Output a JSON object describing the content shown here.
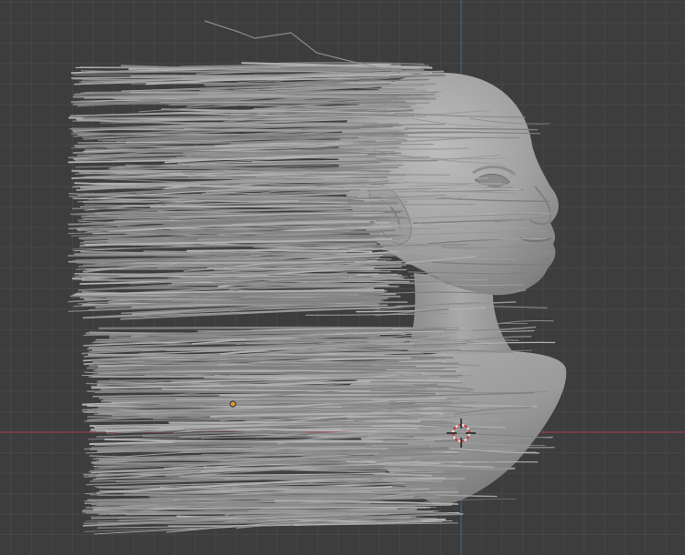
{
  "viewport": {
    "mode": "3d-viewport-orthographic-side",
    "background_color": "#3d3d3d",
    "grid_minor_color": "#464646",
    "grid_major_color": "#4f4f4f",
    "x_axis_color": "#a8404a",
    "z_axis_color": "#3b6fa8",
    "mesh_color": "#9a9a9a",
    "hair_color": "#8c8c8c",
    "origin_color": "#e39a2c"
  },
  "scene": {
    "objects": [
      {
        "name_icon": "head-bust-mesh",
        "type": "mesh",
        "selected": false
      },
      {
        "name_icon": "hair-particle-strands",
        "type": "hair-curves",
        "selected": false
      }
    ],
    "cursor_icon": "3d-cursor-icon",
    "origin_icon": "object-origin-dot"
  }
}
